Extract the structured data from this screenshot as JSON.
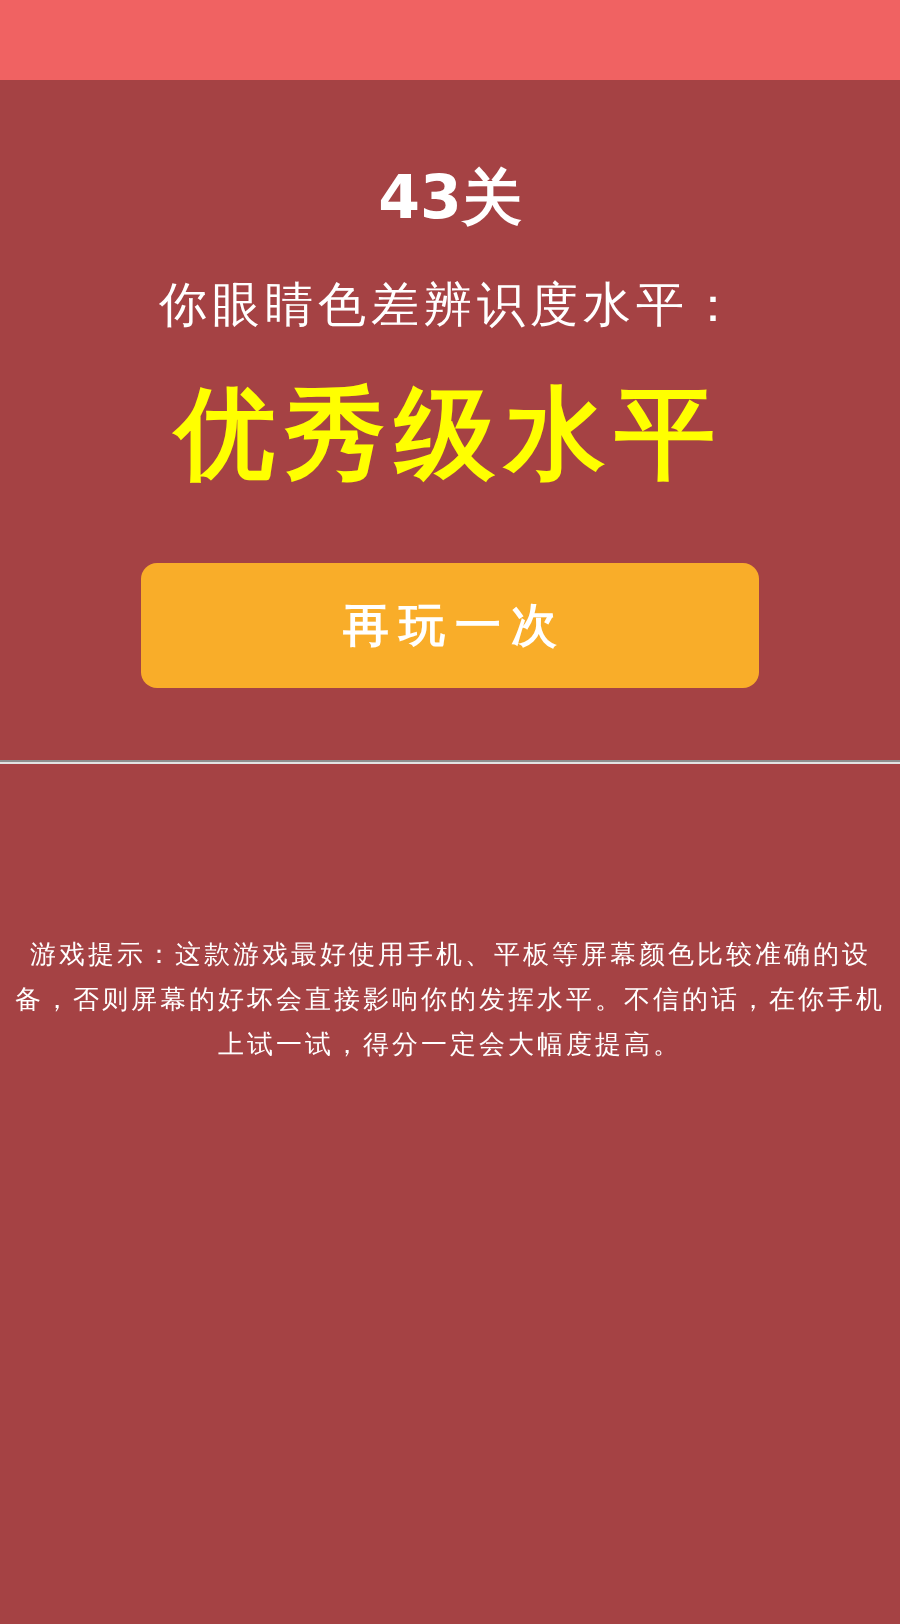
{
  "level": {
    "title": "43关"
  },
  "result": {
    "prompt": "你眼睛色差辨识度水平：",
    "rating": "优秀级水平"
  },
  "buttons": [
    {
      "label": "再玩一次"
    }
  ],
  "hint": {
    "text": "游戏提示：这款游戏最好使用手机、平板等屏幕颜色比较准确的设备，否则屏幕的好坏会直接影响你的发挥水平。不信的话，在你手机上试一试，得分一定会大幅度提高。"
  }
}
